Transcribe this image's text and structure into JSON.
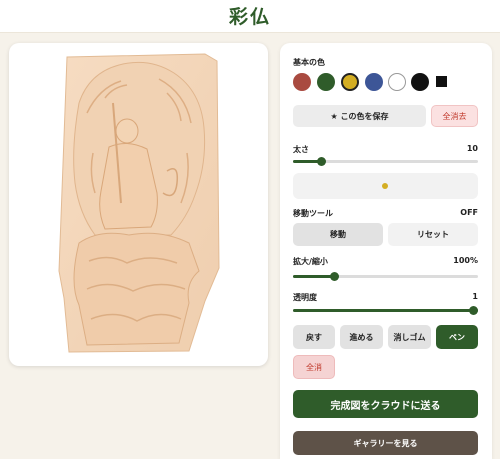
{
  "app": {
    "title": "彩仏"
  },
  "palette": {
    "label": "基本の色",
    "colors": [
      {
        "name": "red",
        "hex": "#a94a40"
      },
      {
        "name": "green",
        "hex": "#2f5c2a"
      },
      {
        "name": "yellow",
        "hex": "#d4ae23"
      },
      {
        "name": "blue",
        "hex": "#3d5697"
      },
      {
        "name": "white",
        "hex": "#ffffff"
      },
      {
        "name": "black",
        "hex": "#111111"
      },
      {
        "name": "black-square",
        "hex": "#111111"
      }
    ],
    "selected": "yellow",
    "save_label": "★ この色を保存",
    "clear_saved_label": "全消去"
  },
  "thickness": {
    "label": "太さ",
    "value": "10",
    "level": 0.15,
    "preview_color": "#d4ae23"
  },
  "move_tool": {
    "label": "移動ツール",
    "state": "OFF",
    "move_label": "移動",
    "reset_label": "リセット"
  },
  "zoom": {
    "label": "拡大/縮小",
    "value": "100%",
    "level": 0.22
  },
  "opacity": {
    "label": "透明度",
    "value": "1",
    "level": 1.0
  },
  "tools": {
    "undo": "戻す",
    "redo": "進める",
    "eraser": "消しゴム",
    "pen": "ペン",
    "clear_all": "全消"
  },
  "actions": {
    "send_cloud": "完成図をクラウドに送る",
    "view_gallery": "ギャラリーを見る"
  }
}
